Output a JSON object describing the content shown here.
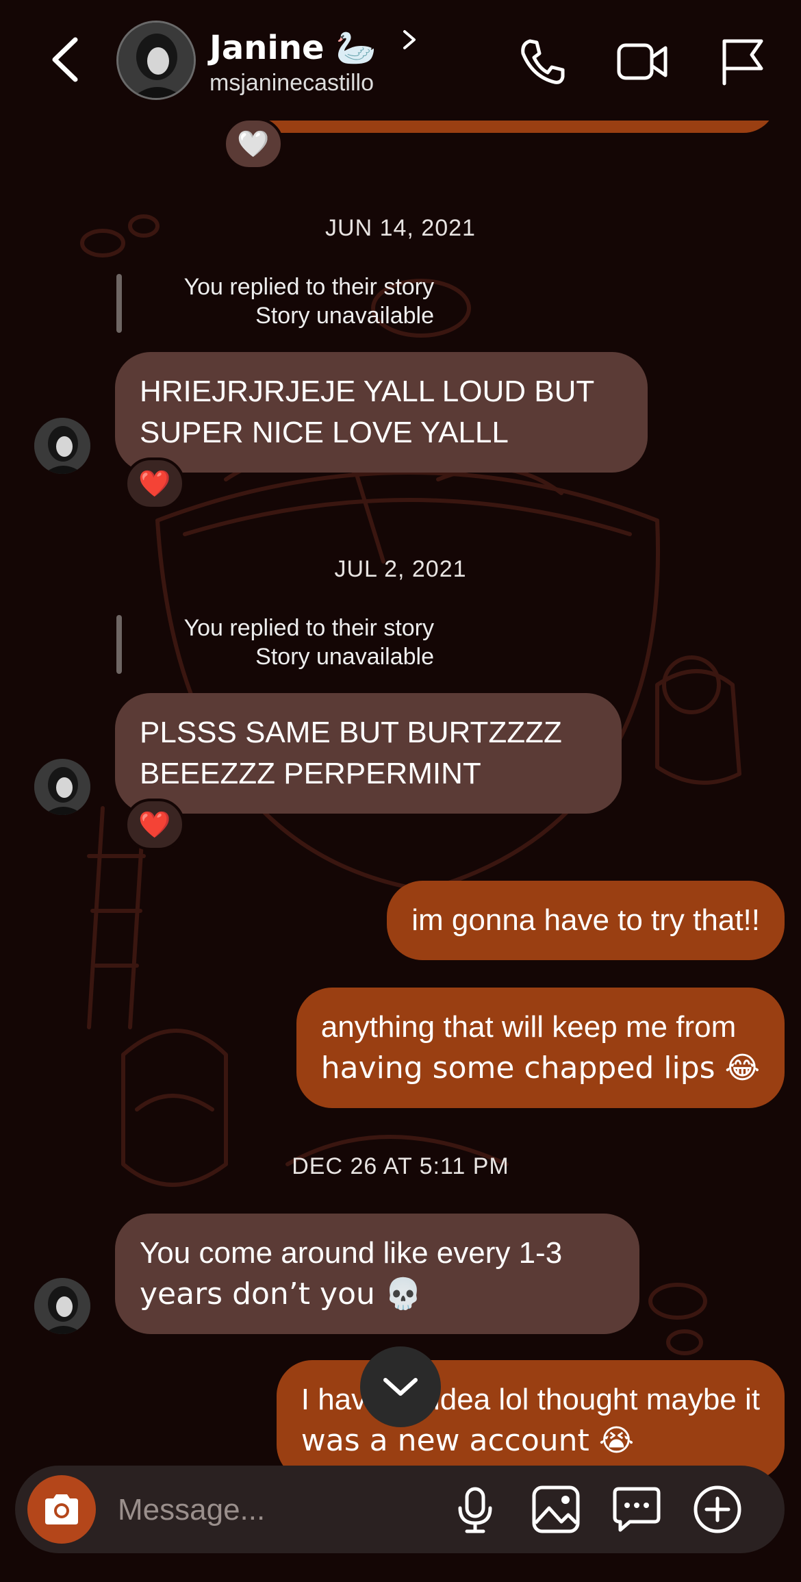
{
  "header": {
    "name": "Janine 🦢",
    "handle": "msjaninecastillo"
  },
  "messages": {
    "top_reaction": "🤍",
    "date1": "JUN 14, 2021",
    "reply1_line1": "You replied to their story",
    "reply1_line2": "Story unavailable",
    "msg1_line1": "HRIEJRJRJEJE YALL LOUD BUT",
    "msg1_line2": "SUPER NICE LOVE YALLL",
    "msg1_reaction": "❤️",
    "date2": "JUL 2, 2021",
    "reply2_line1": "You replied to their story",
    "reply2_line2": "Story unavailable",
    "msg2_line1": "PLSSS SAME BUT BURTZZZZ",
    "msg2_line2": "BEEEZZZ PERPERMINT",
    "msg2_reaction": "❤️",
    "out1": "im gonna have to try that!!",
    "out2_line1": "anything that will keep me from",
    "out2_line2": "having some chapped lips 😂",
    "date3": "DEC 26 AT 5:11 PM",
    "msg3_line1": "You come around like every 1-3",
    "msg3_line2": "years don’t you 💀",
    "out3_line1": "I have no idea lol thought maybe it",
    "out3_line2": "was a new account 😭"
  },
  "composer": {
    "placeholder": "Message..."
  },
  "colors": {
    "background": "#140605",
    "incoming_bubble": "#5b3b36",
    "outgoing_bubble": "#9a3f12",
    "camera_button": "#b4461a"
  }
}
